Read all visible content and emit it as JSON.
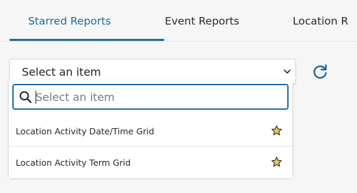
{
  "tabs": [
    {
      "label": "Starred Reports",
      "active": true
    },
    {
      "label": "Event Reports",
      "active": false
    },
    {
      "label": "Location R",
      "active": false
    }
  ],
  "select": {
    "value": "Select an item",
    "icon": "chevron-down-icon"
  },
  "refresh": {
    "icon": "refresh-icon",
    "color": "#1e6a9e"
  },
  "dropdown": {
    "search_placeholder": "Select an item",
    "search_icon": "search-icon",
    "items": [
      {
        "label": "Location Activity Date/Time Grid",
        "starred": true
      },
      {
        "label": "Location Activity Term Grid",
        "starred": true
      }
    ]
  },
  "colors": {
    "accent": "#1e6a9e",
    "star_fill": "#f2c94c",
    "star_outline": "#333333",
    "background": "#f6f6f6"
  }
}
